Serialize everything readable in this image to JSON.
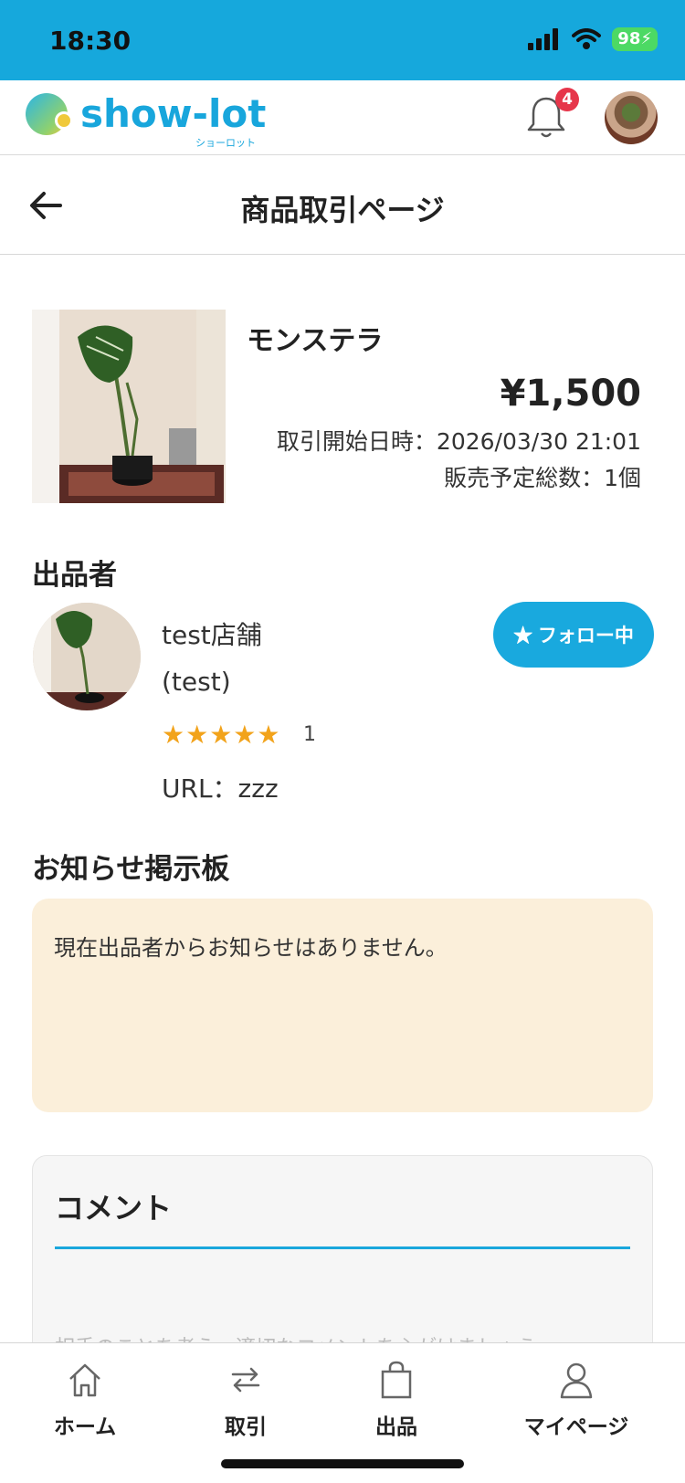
{
  "status_bar": {
    "time": "18:30",
    "battery": "98"
  },
  "header": {
    "logo_text": "show-lot",
    "logo_sub": "ショーロット",
    "notification_count": "4"
  },
  "page": {
    "title": "商品取引ページ"
  },
  "product": {
    "name": "モンステラ",
    "price": "¥1,500",
    "start_datetime": "取引開始日時：2026/03/30 21:01",
    "total_quantity": "販売予定総数：1個"
  },
  "seller": {
    "section_title": "出品者",
    "name": "test店舗",
    "id": "(test)",
    "stars": "★★★★★",
    "rating_count": "1",
    "url": "URL：zzz",
    "follow_label": "★ フォロー中"
  },
  "notice": {
    "section_title": "お知らせ掲示板",
    "text": "現在出品者からお知らせはありません。"
  },
  "comment": {
    "title": "コメント",
    "hint": "相手のことを考え、適切なコメントを心がけましょう。"
  },
  "tabs": [
    {
      "label": "ホーム",
      "icon": "home-icon"
    },
    {
      "label": "取引",
      "icon": "exchange-icon"
    },
    {
      "label": "出品",
      "icon": "bag-icon"
    },
    {
      "label": "マイページ",
      "icon": "person-icon"
    }
  ],
  "colors": {
    "accent": "#19a9de",
    "star": "#f2a31b",
    "notice_bg": "#fbefda",
    "badge": "#e6364a"
  }
}
